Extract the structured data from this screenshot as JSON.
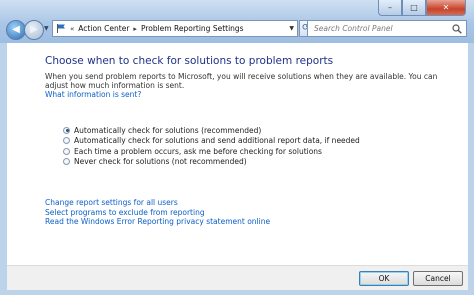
{
  "window": {
    "minimize": "–",
    "maximize": "□",
    "close": "✕"
  },
  "nav": {
    "back": "◀",
    "forward": "▶",
    "history": "▼"
  },
  "address": {
    "prefix": "«",
    "crumbs": [
      "Action Center",
      "Problem Reporting Settings"
    ],
    "separator": "▸"
  },
  "search": {
    "placeholder": "Search Control Panel"
  },
  "main": {
    "heading": "Choose when to check for solutions to problem reports",
    "description": "When you send problem reports to Microsoft, you will receive solutions when they are available. You can adjust how much information is sent.",
    "info_link": "What information is sent?",
    "options": [
      {
        "label": "Automatically check for solutions (recommended)",
        "selected": true
      },
      {
        "label": "Automatically check for solutions and send additional report data, if needed",
        "selected": false
      },
      {
        "label": "Each time a problem occurs, ask me before checking for solutions",
        "selected": false
      },
      {
        "label": "Never check for solutions (not recommended)",
        "selected": false
      }
    ],
    "links": [
      "Change report settings for all users",
      "Select programs to exclude from reporting",
      "Read the Windows Error Reporting privacy statement online"
    ]
  },
  "footer": {
    "ok": "OK",
    "cancel": "Cancel"
  },
  "colors": {
    "heading": "#1e3287",
    "link": "#0b5fc6",
    "chrome": "#aac6e6"
  }
}
